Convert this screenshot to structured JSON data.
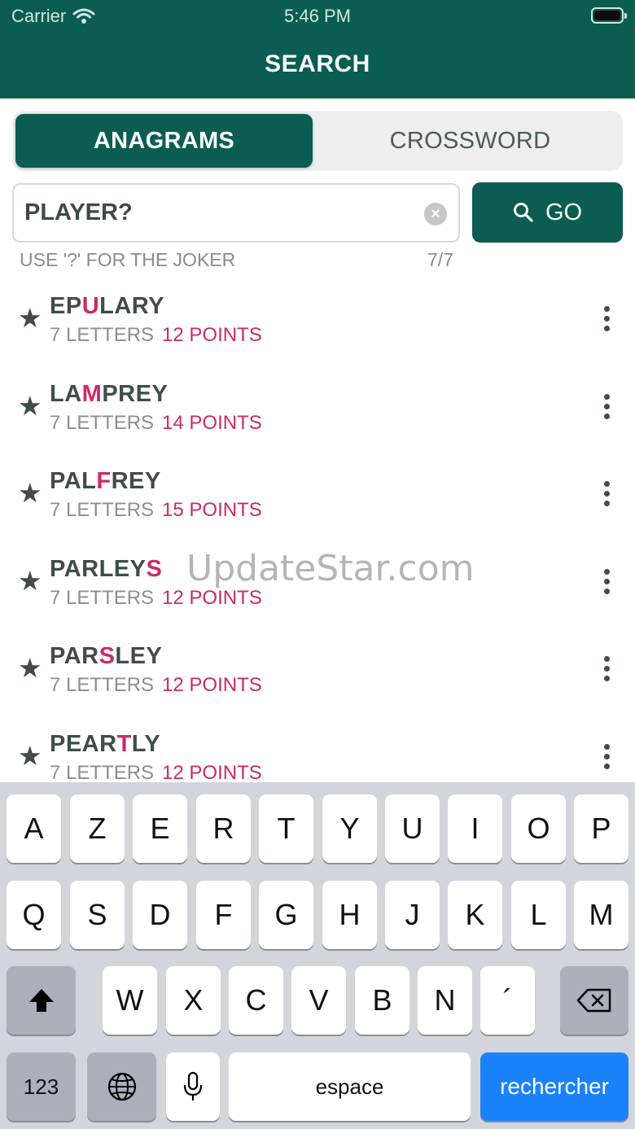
{
  "status_bar": {
    "carrier": "Carrier",
    "time": "5:46 PM"
  },
  "header": {
    "title": "SEARCH"
  },
  "tabs": [
    {
      "label": "ANAGRAMS",
      "active": true
    },
    {
      "label": "CROSSWORD",
      "active": false
    }
  ],
  "search": {
    "value": "PLAYER?",
    "go_label": "GO",
    "hint": "USE '?' FOR THE JOKER",
    "count": "7/7"
  },
  "results": [
    {
      "pre": "EP",
      "hl": "U",
      "post": "LARY",
      "letters": "7 LETTERS",
      "points": "12 POINTS"
    },
    {
      "pre": "LA",
      "hl": "M",
      "post": "PREY",
      "letters": "7 LETTERS",
      "points": "14 POINTS"
    },
    {
      "pre": "PAL",
      "hl": "F",
      "post": "REY",
      "letters": "7 LETTERS",
      "points": "15 POINTS"
    },
    {
      "pre": "PARLEY",
      "hl": "S",
      "post": "",
      "letters": "7 LETTERS",
      "points": "12 POINTS"
    },
    {
      "pre": "PAR",
      "hl": "S",
      "post": "LEY",
      "letters": "7 LETTERS",
      "points": "12 POINTS"
    },
    {
      "pre": "PEAR",
      "hl": "T",
      "post": "LY",
      "letters": "7 LETTERS",
      "points": "12 POINTS"
    }
  ],
  "watermark": "UpdateStar.com",
  "keyboard": {
    "row1": [
      "A",
      "Z",
      "E",
      "R",
      "T",
      "Y",
      "U",
      "I",
      "O",
      "P"
    ],
    "row2": [
      "Q",
      "S",
      "D",
      "F",
      "G",
      "H",
      "J",
      "K",
      "L",
      "M"
    ],
    "row3": [
      "W",
      "X",
      "C",
      "V",
      "B",
      "N",
      "´"
    ],
    "numbers_label": "123",
    "space_label": "espace",
    "action_label": "rechercher"
  },
  "colors": {
    "brand": "#0b5d52",
    "highlight": "#cc2a68",
    "action": "#1a82fb"
  }
}
